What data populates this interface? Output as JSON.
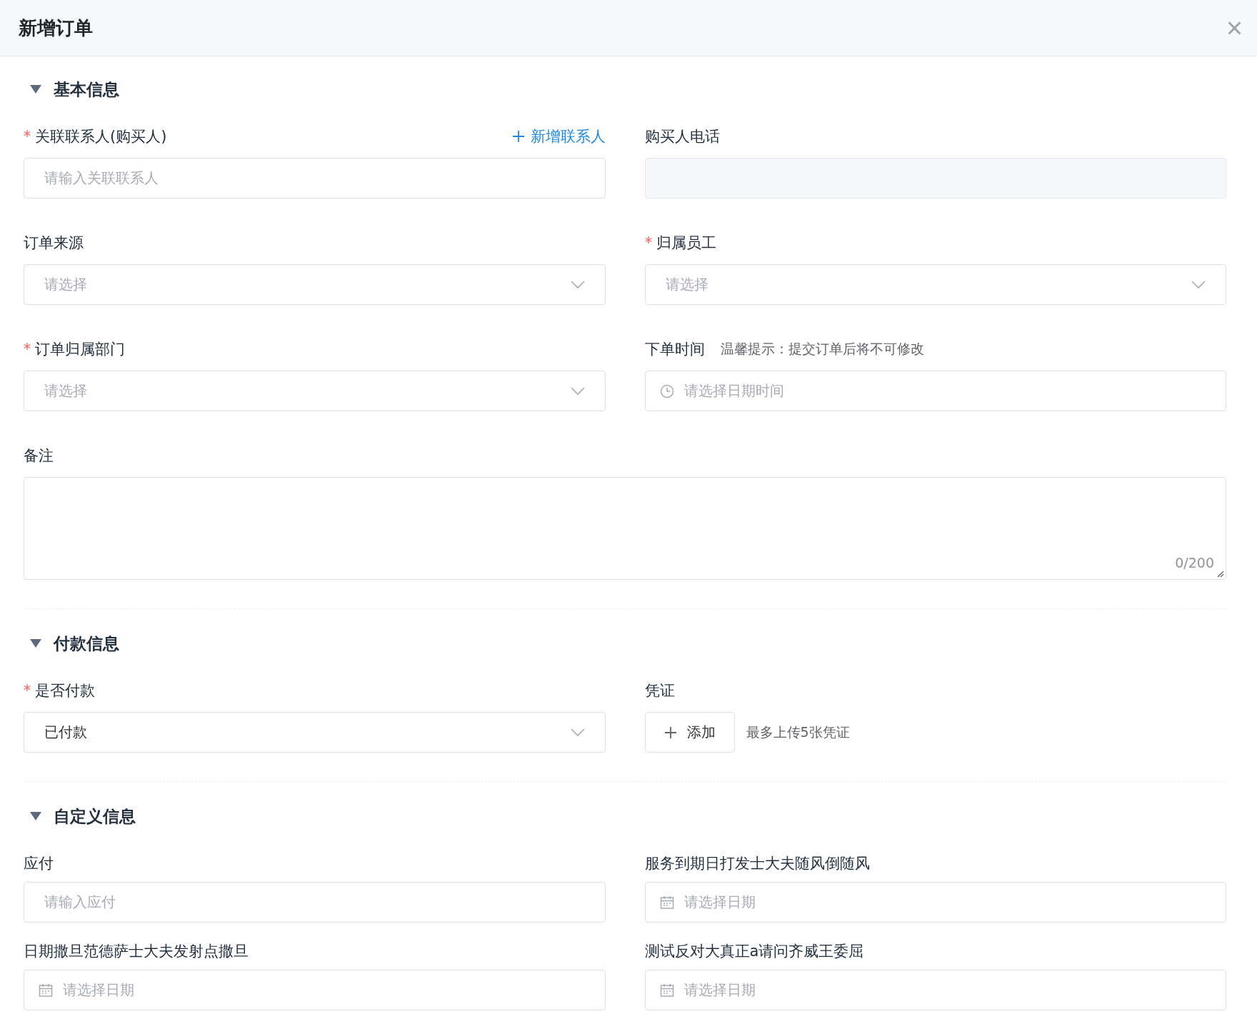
{
  "dialog": {
    "title": "新增订单",
    "close": "×"
  },
  "sections": [
    {
      "title": "基本信息",
      "expanded": true,
      "fields": [
        {
          "kind": "text",
          "label": "关联联系人(购买人)",
          "required": true,
          "placeholder": "请输入关联联系人",
          "link": "新增联系人"
        },
        {
          "kind": "readonly",
          "label": "购买人电话",
          "required": false
        },
        {
          "kind": "select",
          "label": "订单来源",
          "required": false,
          "placeholder": "请选择"
        },
        {
          "kind": "select",
          "label": "归属员工",
          "required": true,
          "placeholder": "请选择"
        },
        {
          "kind": "select",
          "label": "订单归属部门",
          "required": true,
          "placeholder": "请选择"
        },
        {
          "kind": "datetime",
          "label": "下单时间",
          "required": false,
          "hint": "温馨提示：提交订单后将不可修改",
          "placeholder": "请选择日期时间"
        },
        {
          "kind": "textarea",
          "label": "备注",
          "required": false,
          "counter": "0/200"
        }
      ]
    },
    {
      "title": "付款信息",
      "expanded": true,
      "fields": [
        {
          "kind": "select",
          "label": "是否付款",
          "required": true,
          "value": "已付款"
        },
        {
          "kind": "upload",
          "label": "凭证",
          "required": false,
          "button": "添加",
          "hint": "最多上传5张凭证"
        }
      ]
    },
    {
      "title": "自定义信息",
      "expanded": true,
      "fields": [
        {
          "kind": "text",
          "label": "应付",
          "required": false,
          "placeholder": "请输入应付"
        },
        {
          "kind": "date",
          "label": "服务到期日打发士大夫随风倒随风",
          "required": false,
          "placeholder": "请选择日期"
        },
        {
          "kind": "date",
          "label": "日期撒旦范德萨士大夫发射点撒旦",
          "required": false,
          "placeholder": "请选择日期"
        },
        {
          "kind": "date",
          "label": "测试反对大真正a请问齐威王委屈",
          "required": false,
          "placeholder": "请选择日期"
        }
      ]
    }
  ]
}
